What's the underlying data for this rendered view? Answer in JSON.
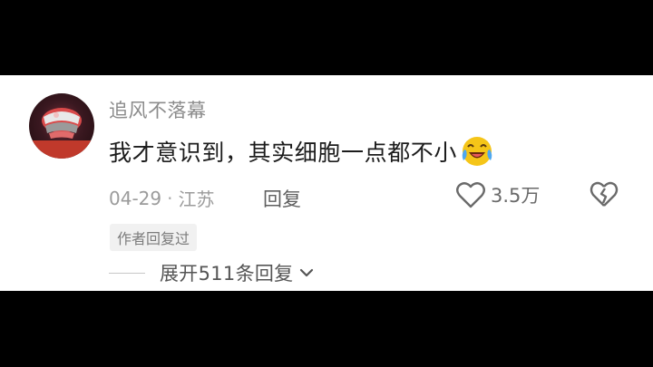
{
  "comment": {
    "username": "追风不落幕",
    "text": "我才意识到，其实细胞一点都不小",
    "emoji": "laughing-crying-emoji",
    "date": "04-29",
    "separator": "·",
    "location": "江苏",
    "reply_label": "回复",
    "likes": "3.5万",
    "author_replied_badge": "作者回复过",
    "expand_replies_label": "展开511条回复"
  },
  "colors": {
    "background": "#ffffff",
    "letterbox": "#000000",
    "username": "#8b8b8b",
    "text": "#1c1c1c",
    "meta": "#9b9b9b"
  },
  "icons": [
    "heart-outline-icon",
    "broken-heart-icon",
    "chevron-down-icon"
  ]
}
